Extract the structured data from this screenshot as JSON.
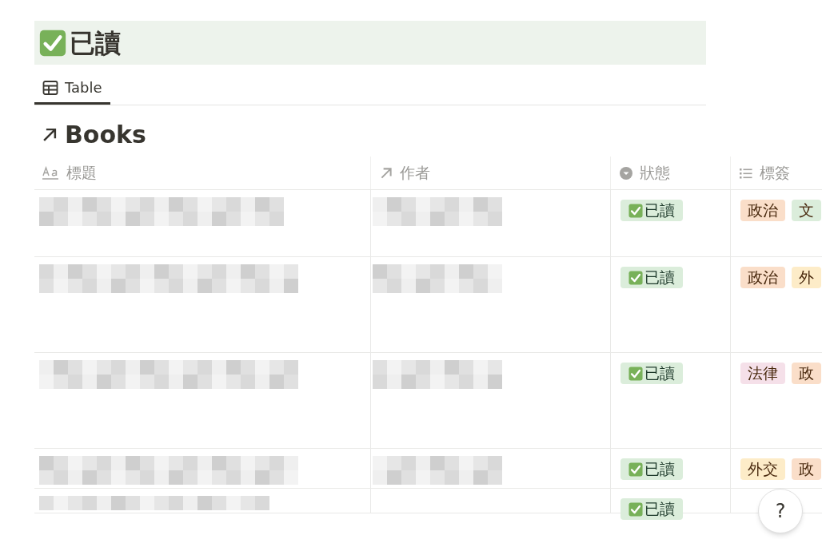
{
  "page": {
    "title": "已讀"
  },
  "tabs": [
    {
      "label": "Table",
      "selected": true
    }
  ],
  "database": {
    "title": "Books"
  },
  "columns": [
    {
      "kind": "text",
      "label": "標題"
    },
    {
      "kind": "relation",
      "label": "作者"
    },
    {
      "kind": "status",
      "label": "狀態"
    },
    {
      "kind": "multi",
      "label": "標簽"
    }
  ],
  "rows": [
    {
      "status": "已讀",
      "tags": [
        {
          "label": "政治",
          "color": "#fadec9"
        },
        {
          "label": "文",
          "color": "#dbeddb"
        }
      ]
    },
    {
      "status": "已讀",
      "tags": [
        {
          "label": "政治",
          "color": "#fadec9"
        },
        {
          "label": "外",
          "color": "#fdecc8"
        }
      ]
    },
    {
      "status": "已讀",
      "tags": [
        {
          "label": "法律",
          "color": "#f5e0e9"
        },
        {
          "label": "政",
          "color": "#fadec9"
        }
      ]
    },
    {
      "status": "已讀",
      "tags": [
        {
          "label": "外交",
          "color": "#fdecc8"
        },
        {
          "label": "政",
          "color": "#fadec9"
        }
      ]
    },
    {
      "status": "已讀",
      "tags": []
    }
  ],
  "help_button": "?"
}
